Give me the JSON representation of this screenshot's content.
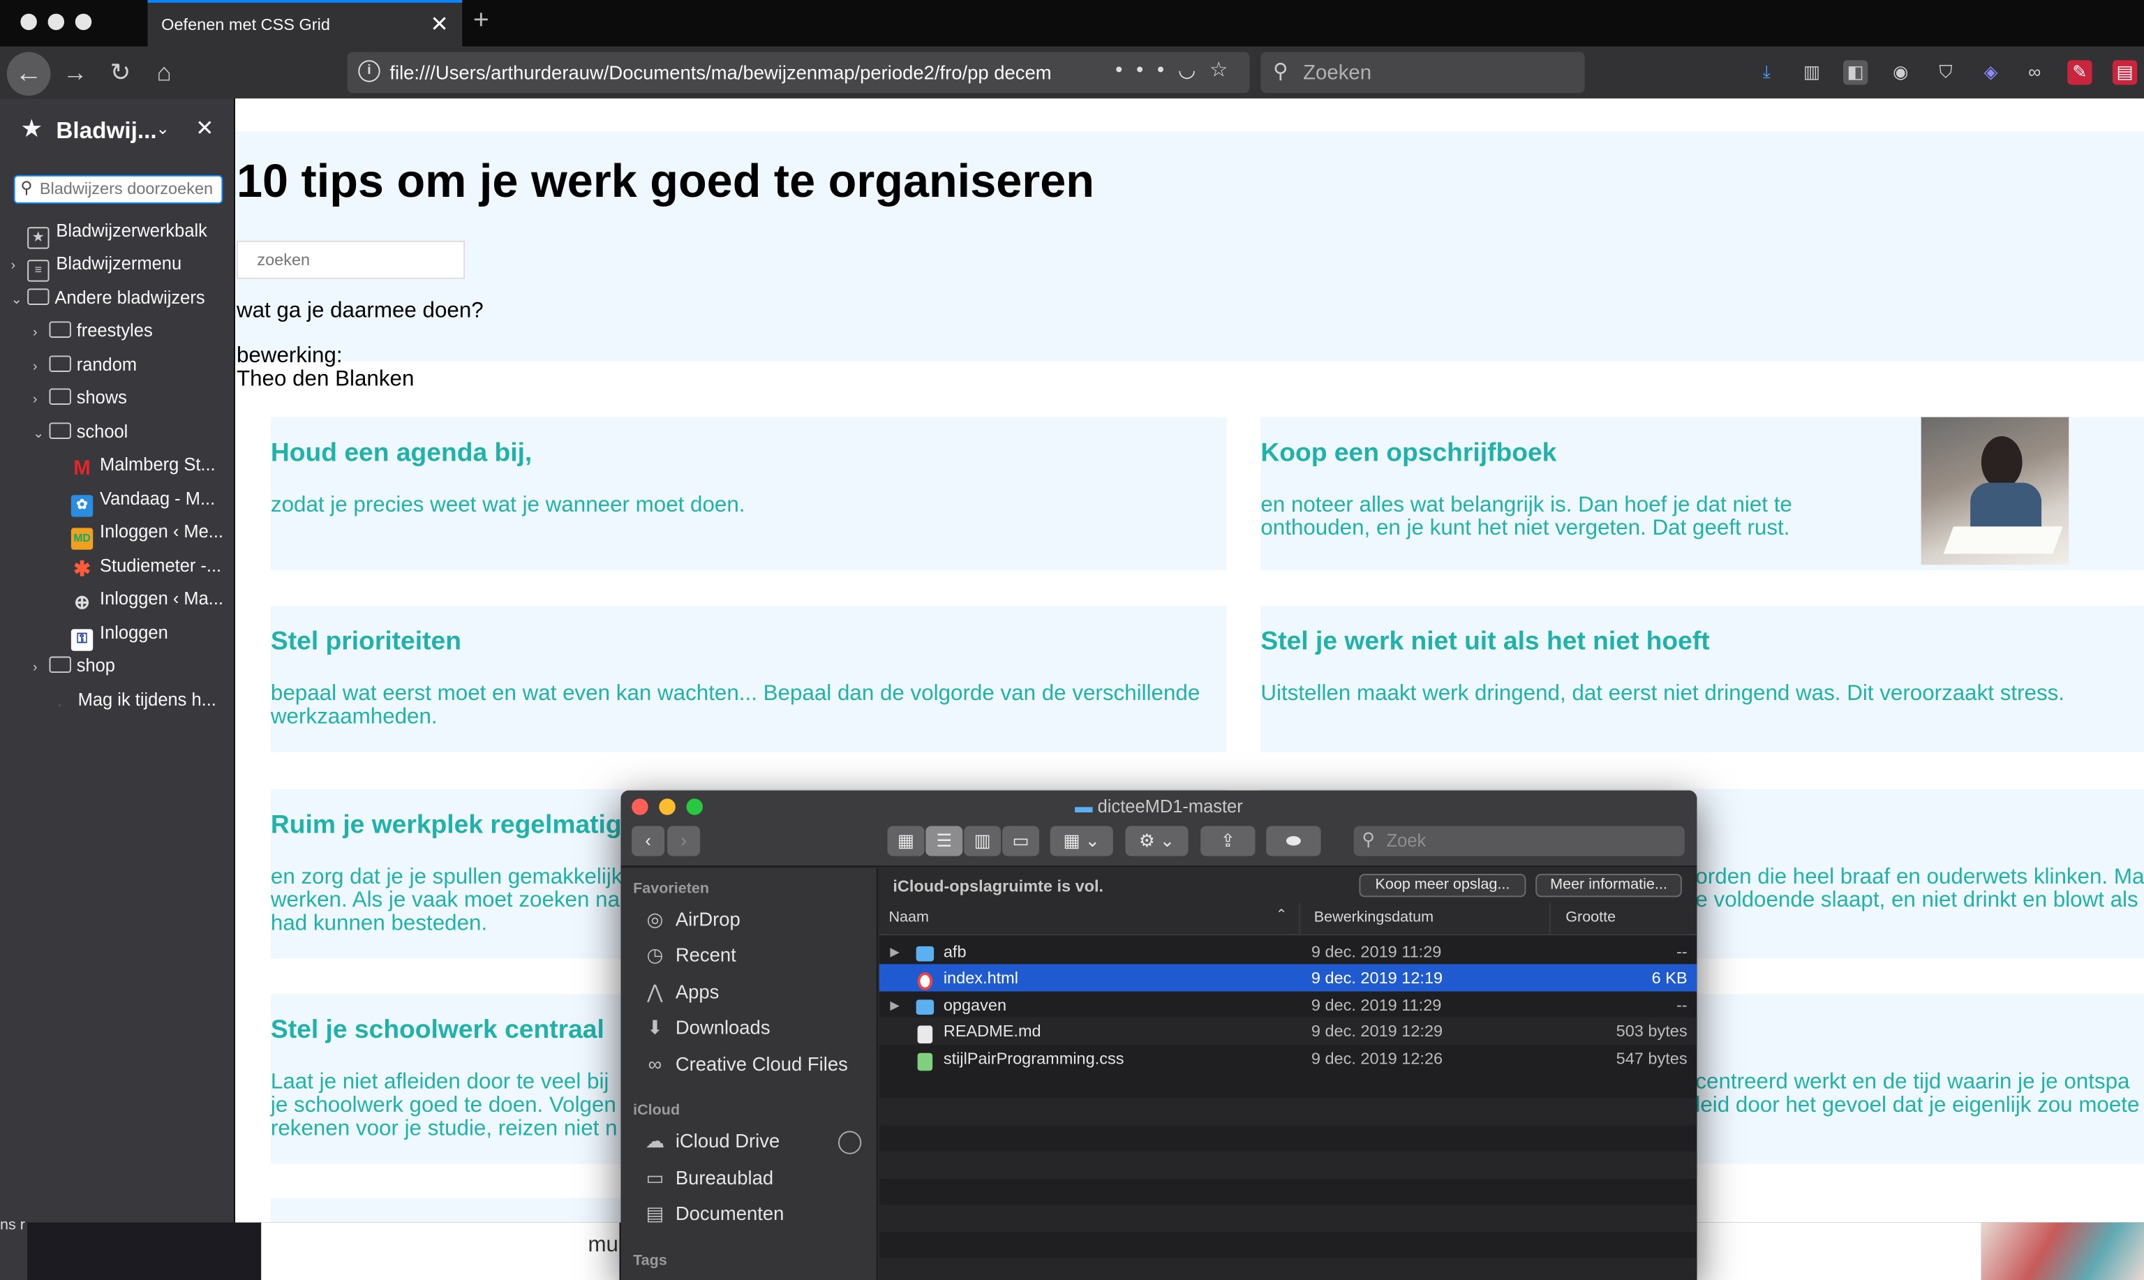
{
  "browser": {
    "tab_title": "Oefenen met CSS Grid",
    "url": "file:///Users/arthurderauw/Documents/ma/bewijzenmap/periode2/fro/pp decem",
    "search_placeholder": "Zoeken"
  },
  "sidebar": {
    "title": "Bladwij...",
    "search_placeholder": "Bladwijzers doorzoeken",
    "items": [
      {
        "label": "Bladwijzerwerkbalk"
      },
      {
        "label": "Bladwijzermenu"
      },
      {
        "label": "Andere bladwijzers"
      },
      {
        "label": "freestyles"
      },
      {
        "label": "random"
      },
      {
        "label": "shows"
      },
      {
        "label": "school"
      },
      {
        "label": "Malmberg St..."
      },
      {
        "label": "Vandaag - M..."
      },
      {
        "label": "Inloggen ‹ Me..."
      },
      {
        "label": "Studiemeter -..."
      },
      {
        "label": "Inloggen ‹ Ma..."
      },
      {
        "label": "Inloggen"
      },
      {
        "label": "shop"
      },
      {
        "label": "Mag ik tijdens h..."
      }
    ]
  },
  "page": {
    "title": "10 tips om je werk goed te organiseren",
    "search_placeholder": "zoeken",
    "question": "wat ga je daarmee doen?",
    "credit_label": "bewerking:",
    "credit_name": "Theo den Blanken",
    "cards": [
      {
        "title": "Houd een agenda bij,",
        "text": "zodat je precies weet wat je wanneer moet doen."
      },
      {
        "title": "Koop een opschrijfboek",
        "text": "en noteer alles wat belangrijk is. Dan hoef je dat niet te onthouden, en je kunt het niet vergeten. Dat geeft rust."
      },
      {
        "title": "Stel prioriteiten",
        "text": "bepaal wat eerst moet en wat even kan wachten... Bepaal dan de volgorde van de verschillende werkzaamheden."
      },
      {
        "title": "Stel je werk niet uit als het niet hoeft",
        "text": "Uitstellen maakt werk dringend, dat eerst niet dringend was. Dit veroorzaakt stress."
      },
      {
        "title": "Ruim je werkplek regelmatig",
        "text_1": "en zorg dat je je spullen gemakkelijk",
        "text_2": "werken. Als je vaak moet zoeken na",
        "text_3": "had kunnen besteden."
      },
      {
        "text_1": "orden die heel braaf en ouderwets klinken. Ma",
        "text_2": "e voldoende slaapt, en niet drinkt en blowt als"
      },
      {
        "title": "Stel je schoolwerk centraal",
        "text_1": "Laat je niet afleiden door te veel bij",
        "text_2": "je schoolwerk goed te doen. Volgen",
        "text_3": "rekenen voor je studie, reizen niet n"
      },
      {
        "text_1": "centreerd werkt en de tijd waarin je je ontspa",
        "text_2": "leid door het gevoel dat je eigenlijk zou moete"
      }
    ],
    "behind_fragments": [
      "mu",
      "ns r"
    ]
  },
  "finder": {
    "title": "dicteeMD1-master",
    "search_placeholder": "Zoek",
    "sidebar_heading_favorites": "Favorieten",
    "favorites": [
      {
        "label": "AirDrop",
        "icon": "airdrop-icon"
      },
      {
        "label": "Recent",
        "icon": "clock-icon"
      },
      {
        "label": "Apps",
        "icon": "apps-icon"
      },
      {
        "label": "Downloads",
        "icon": "download-icon"
      },
      {
        "label": "Creative Cloud Files",
        "icon": "creative-cloud-icon"
      }
    ],
    "sidebar_heading_icloud": "iCloud",
    "icloud": [
      {
        "label": "iCloud Drive",
        "icon": "cloud-icon"
      },
      {
        "label": "Bureaublad",
        "icon": "desktop-icon"
      },
      {
        "label": "Documenten",
        "icon": "document-icon"
      }
    ],
    "sidebar_heading_tags": "Tags",
    "icloud_message": "iCloud-opslagruimte is vol.",
    "buy_button": "Koop meer opslag...",
    "info_button": "Meer informatie...",
    "columns": {
      "name": "Naam",
      "date": "Bewerkingsdatum",
      "size": "Grootte"
    },
    "files": [
      {
        "name": "afb",
        "date": "9 dec. 2019 11:29",
        "size": "--",
        "kind": "folder"
      },
      {
        "name": "index.html",
        "date": "9 dec. 2019 12:19",
        "size": "6 KB",
        "kind": "html",
        "selected": true
      },
      {
        "name": "opgaven",
        "date": "9 dec. 2019 11:29",
        "size": "--",
        "kind": "folder"
      },
      {
        "name": "README.md",
        "date": "9 dec. 2019 12:29",
        "size": "503 bytes",
        "kind": "text"
      },
      {
        "name": "stijlPairProgramming.css",
        "date": "9 dec. 2019 12:26",
        "size": "547 bytes",
        "kind": "css"
      }
    ]
  },
  "colors": {
    "accent": "#20b2aa",
    "card_bg": "#f0f8ff",
    "selection": "#1f5ad1",
    "tab_highlight": "#0a84ff"
  }
}
